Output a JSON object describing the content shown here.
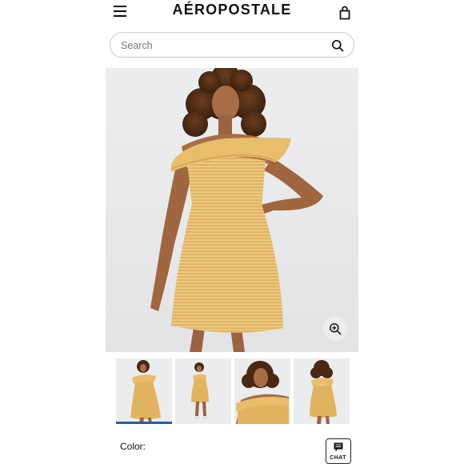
{
  "header": {
    "logo_text": "AÉROPOSTALE",
    "menu_icon": "hamburger-menu-icon",
    "bag_icon": "shopping-bag-icon"
  },
  "search": {
    "placeholder": "Search",
    "value": "",
    "icon": "search-icon"
  },
  "product": {
    "main_image": "model-in-yellow-off-shoulder-striped-dress",
    "zoom_icon": "zoom-in-icon",
    "dress_color": "#E2B35F",
    "thumbnails": [
      {
        "view": "front-full",
        "active": true
      },
      {
        "view": "front-far",
        "active": false
      },
      {
        "view": "close-up",
        "active": false
      },
      {
        "view": "back",
        "active": false
      }
    ],
    "color_label": "Color:"
  },
  "chat": {
    "label": "CHAT",
    "icon": "chat-bubble-icon"
  },
  "colors": {
    "accent": "#1F5FA8",
    "text": "#111111",
    "border": "#CFCFCF"
  }
}
